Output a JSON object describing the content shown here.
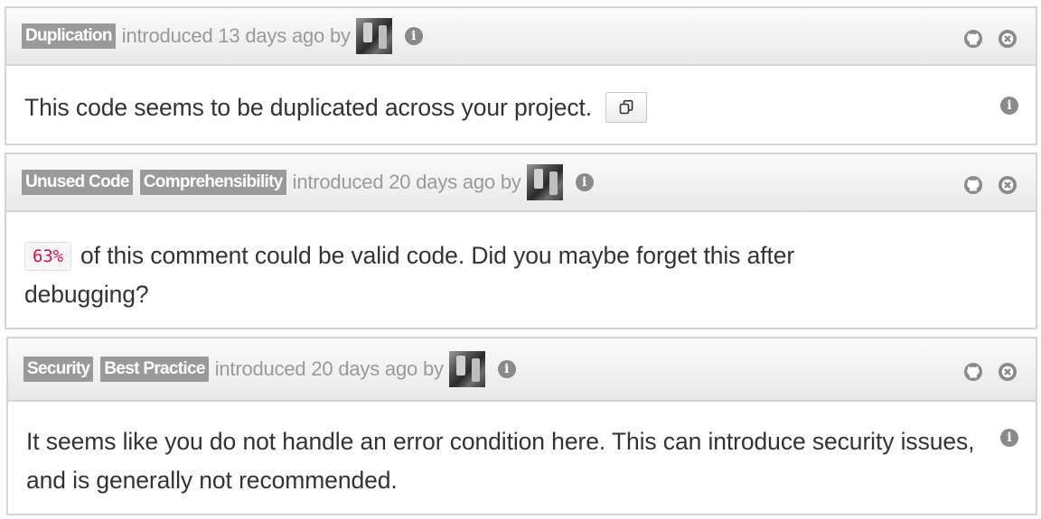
{
  "issues": [
    {
      "tags": [
        "Duplication"
      ],
      "meta": "introduced 13 days ago by",
      "message": "This code seems to be duplicated across your project."
    },
    {
      "tags": [
        "Unused Code",
        "Comprehensibility"
      ],
      "meta": "introduced 20 days ago by",
      "percent": "63%",
      "message": "of this comment could be valid code. Did you maybe forget this after debugging?"
    },
    {
      "tags": [
        "Security",
        "Best Practice"
      ],
      "meta": "introduced 20 days ago by",
      "message": "It seems like you do not handle an error condition here. This can introduce security issues, and is generally not recommended."
    }
  ],
  "icons": {
    "info": "info-icon",
    "github": "github-icon",
    "dismiss": "close-icon",
    "copy": "copy-icon"
  },
  "colors": {
    "tag_bg": "#9a9a9a",
    "meta_text": "#9a9a9a",
    "border": "#d4d4d4",
    "percent_text": "#dd1144"
  }
}
